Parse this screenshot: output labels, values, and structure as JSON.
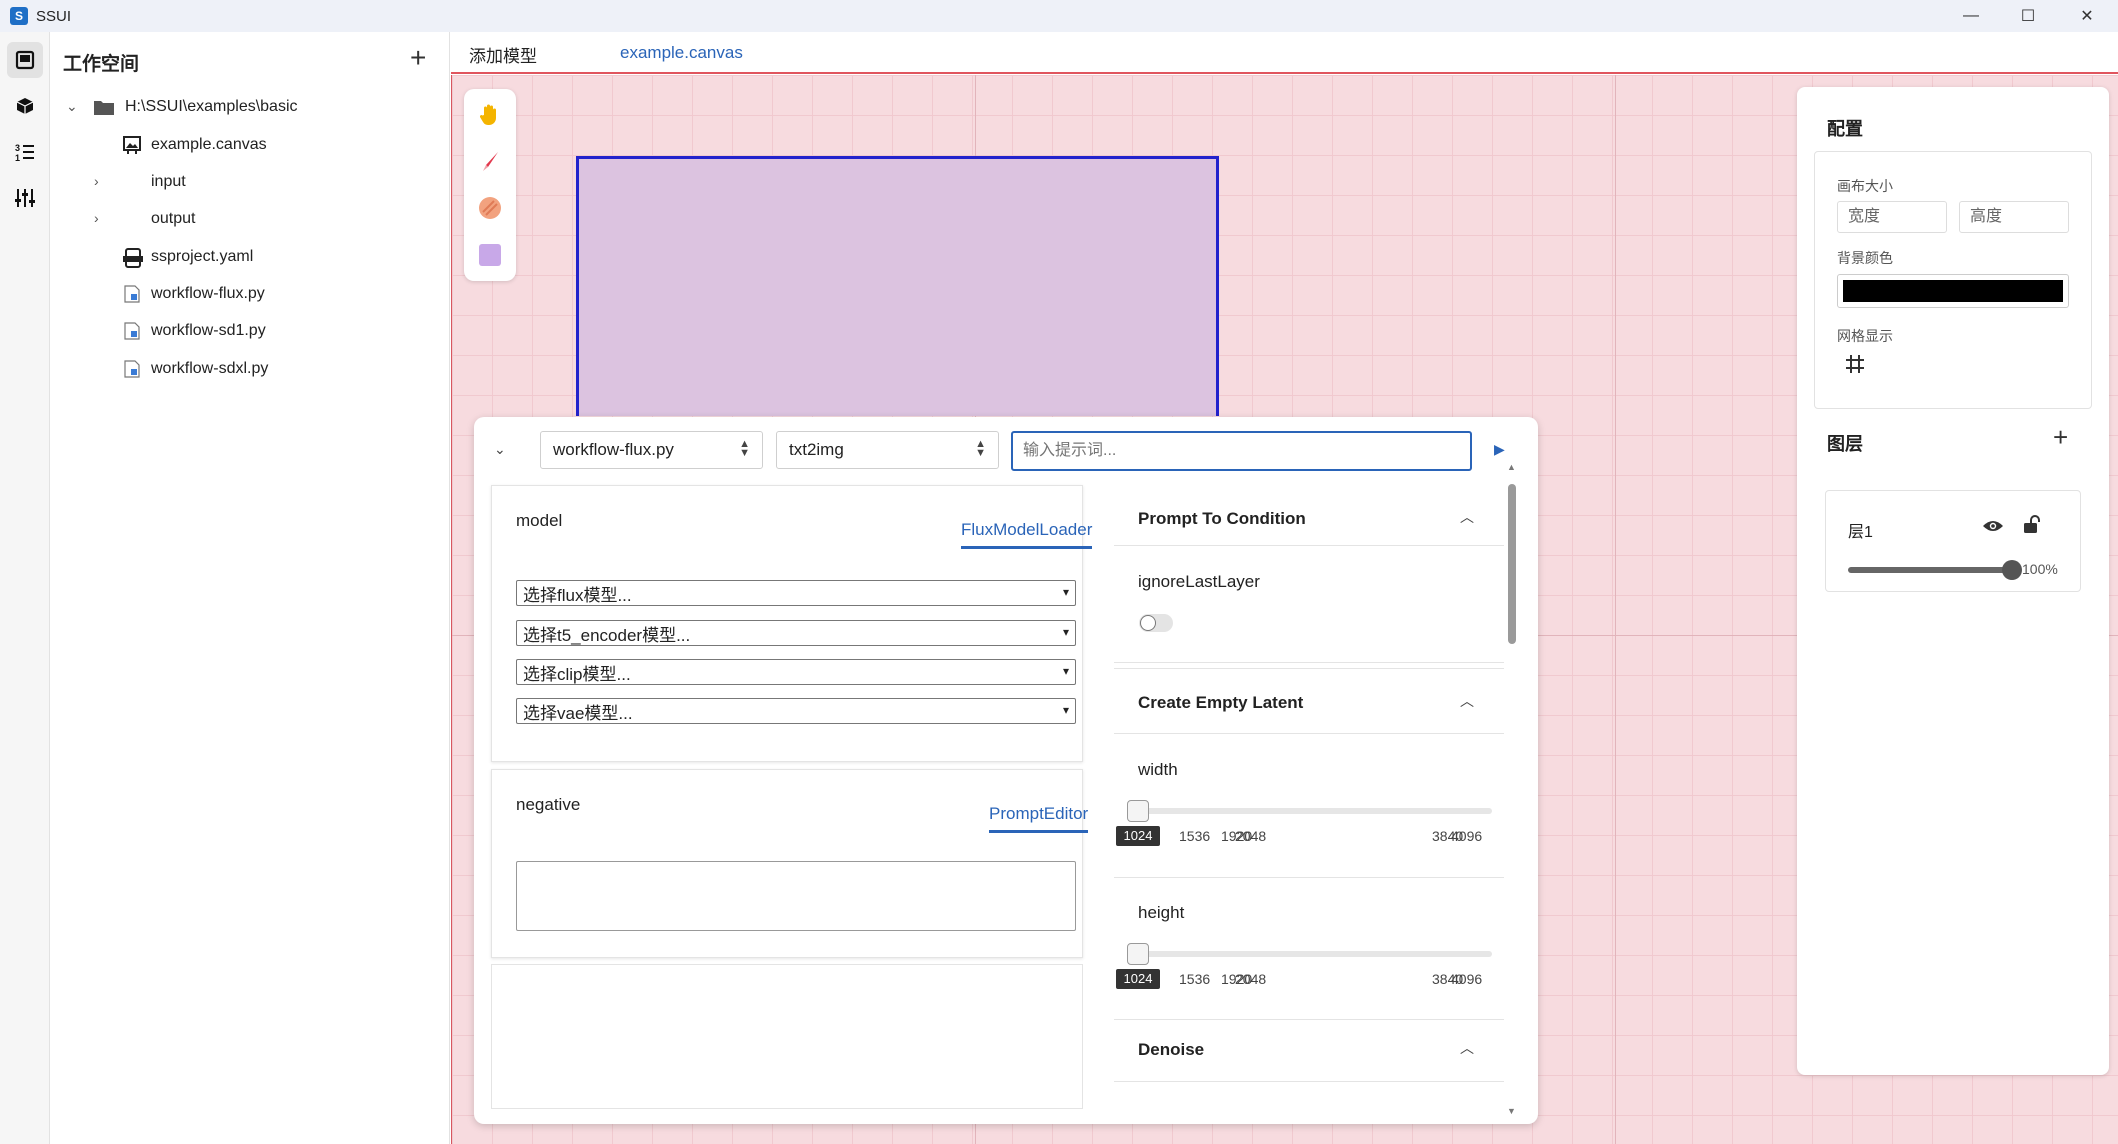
{
  "app": {
    "title": "SSUI",
    "icon_letter": "S"
  },
  "window_controls": {
    "minimize": "—",
    "maximize": "☐",
    "close": "✕"
  },
  "activity_bar": {
    "items": [
      "workspace-icon",
      "model-icon",
      "list-icon",
      "sliders-icon"
    ]
  },
  "sidebar": {
    "title": "工作空间",
    "add": "+",
    "tree": [
      {
        "label": "H:\\SSUI\\examples\\basic",
        "type": "folder",
        "expanded": true
      },
      {
        "label": "example.canvas",
        "type": "canvas-file"
      },
      {
        "label": "input",
        "type": "folder",
        "expanded": false
      },
      {
        "label": "output",
        "type": "folder",
        "expanded": false
      },
      {
        "label": "ssproject.yaml",
        "type": "yaml-file"
      },
      {
        "label": "workflow-flux.py",
        "type": "py-file"
      },
      {
        "label": "workflow-sd1.py",
        "type": "py-file"
      },
      {
        "label": "workflow-sdxl.py",
        "type": "py-file"
      }
    ]
  },
  "editor": {
    "tabs": [
      "添加模型",
      "example.canvas"
    ],
    "toolbox": [
      "hand-icon",
      "brush-icon",
      "eraser-icon",
      "rectangle-icon"
    ]
  },
  "workflow": {
    "script_select": "workflow-flux.py",
    "mode_select": "txt2img",
    "prompt_placeholder": "输入提示词...",
    "model_card": {
      "label": "model",
      "link": "FluxModelLoader",
      "dropdowns": [
        "选择flux模型...",
        "选择t5_encoder模型...",
        "选择clip模型...",
        "选择vae模型..."
      ]
    },
    "negative_card": {
      "label": "negative",
      "link": "PromptEditor"
    },
    "sections": [
      {
        "title": "Prompt To Condition",
        "param": "ignoreLastLayer",
        "toggle": false
      },
      {
        "title": "Create Empty Latent"
      },
      {
        "title": "Denoise"
      }
    ],
    "width": {
      "label": "width",
      "value": "1024",
      "ticks": [
        "1536",
        "1920",
        "2048",
        "3840",
        "4096"
      ]
    },
    "height": {
      "label": "height",
      "value": "1024",
      "ticks": [
        "1536",
        "1920",
        "2048",
        "3840",
        "4096"
      ]
    }
  },
  "config": {
    "title": "配置",
    "canvas_size_label": "画布大小",
    "width_placeholder": "宽度",
    "height_placeholder": "高度",
    "bg_color_label": "背景颜色",
    "bg_color": "#000000",
    "grid_label": "网格显示",
    "layers_title": "图层",
    "layers_add": "+",
    "layer": {
      "name": "层1",
      "opacity": "100%"
    }
  }
}
